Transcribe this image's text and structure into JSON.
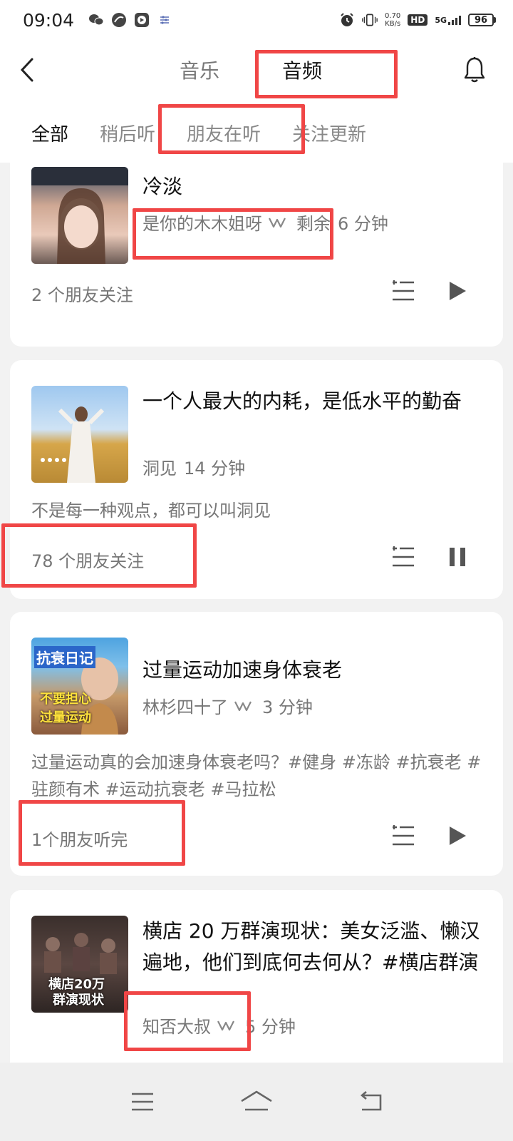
{
  "status_bar": {
    "time": "09:04",
    "net_speed_value": "0.70",
    "net_speed_unit": "KB/s",
    "hd_label": "HD",
    "signal_label": "5G",
    "battery": "96"
  },
  "header": {
    "tabs": [
      {
        "label": "音乐",
        "active": false
      },
      {
        "label": "音频",
        "active": true
      }
    ]
  },
  "subtabs": [
    {
      "label": "全部",
      "active": true
    },
    {
      "label": "稍后听",
      "active": false
    },
    {
      "label": "朋友在听",
      "active": false
    },
    {
      "label": "关注更新",
      "active": false
    }
  ],
  "cards": [
    {
      "title": "冷淡",
      "author": "是你的木木姐呀",
      "remaining": "剩余",
      "duration": "6 分钟",
      "footer": "2 个朋友关注",
      "playing": false
    },
    {
      "title": "一个人最大的内耗，是低水平的勤奋",
      "author": "洞见",
      "duration": "14 分钟",
      "description": "不是每一种观点，都可以叫洞见",
      "footer": "78 个朋友关注",
      "playing": true
    },
    {
      "title": "过量运动加速身体衰老",
      "author": "林杉四十了",
      "duration": "3 分钟",
      "thumb_text_1": "抗衰日记",
      "thumb_text_2": "不要担心",
      "thumb_text_3": "过量运动",
      "description": "过量运动真的会加速身体衰老吗？#健身 #冻龄 #抗衰老 #驻颜有术 #运动抗衰老 #马拉松",
      "footer": "1个朋友听完",
      "playing": false
    },
    {
      "title": "横店 20 万群演现状：美女泛滥、懒汉遍地，他们到底何去何从？#横店群演",
      "author": "知否大叔",
      "duration": "5 分钟",
      "thumb_text_1": "横店20万",
      "thumb_text_2": "群演现状"
    }
  ],
  "colors": {
    "highlight": "#f04646",
    "background": "#f2f2f2"
  }
}
